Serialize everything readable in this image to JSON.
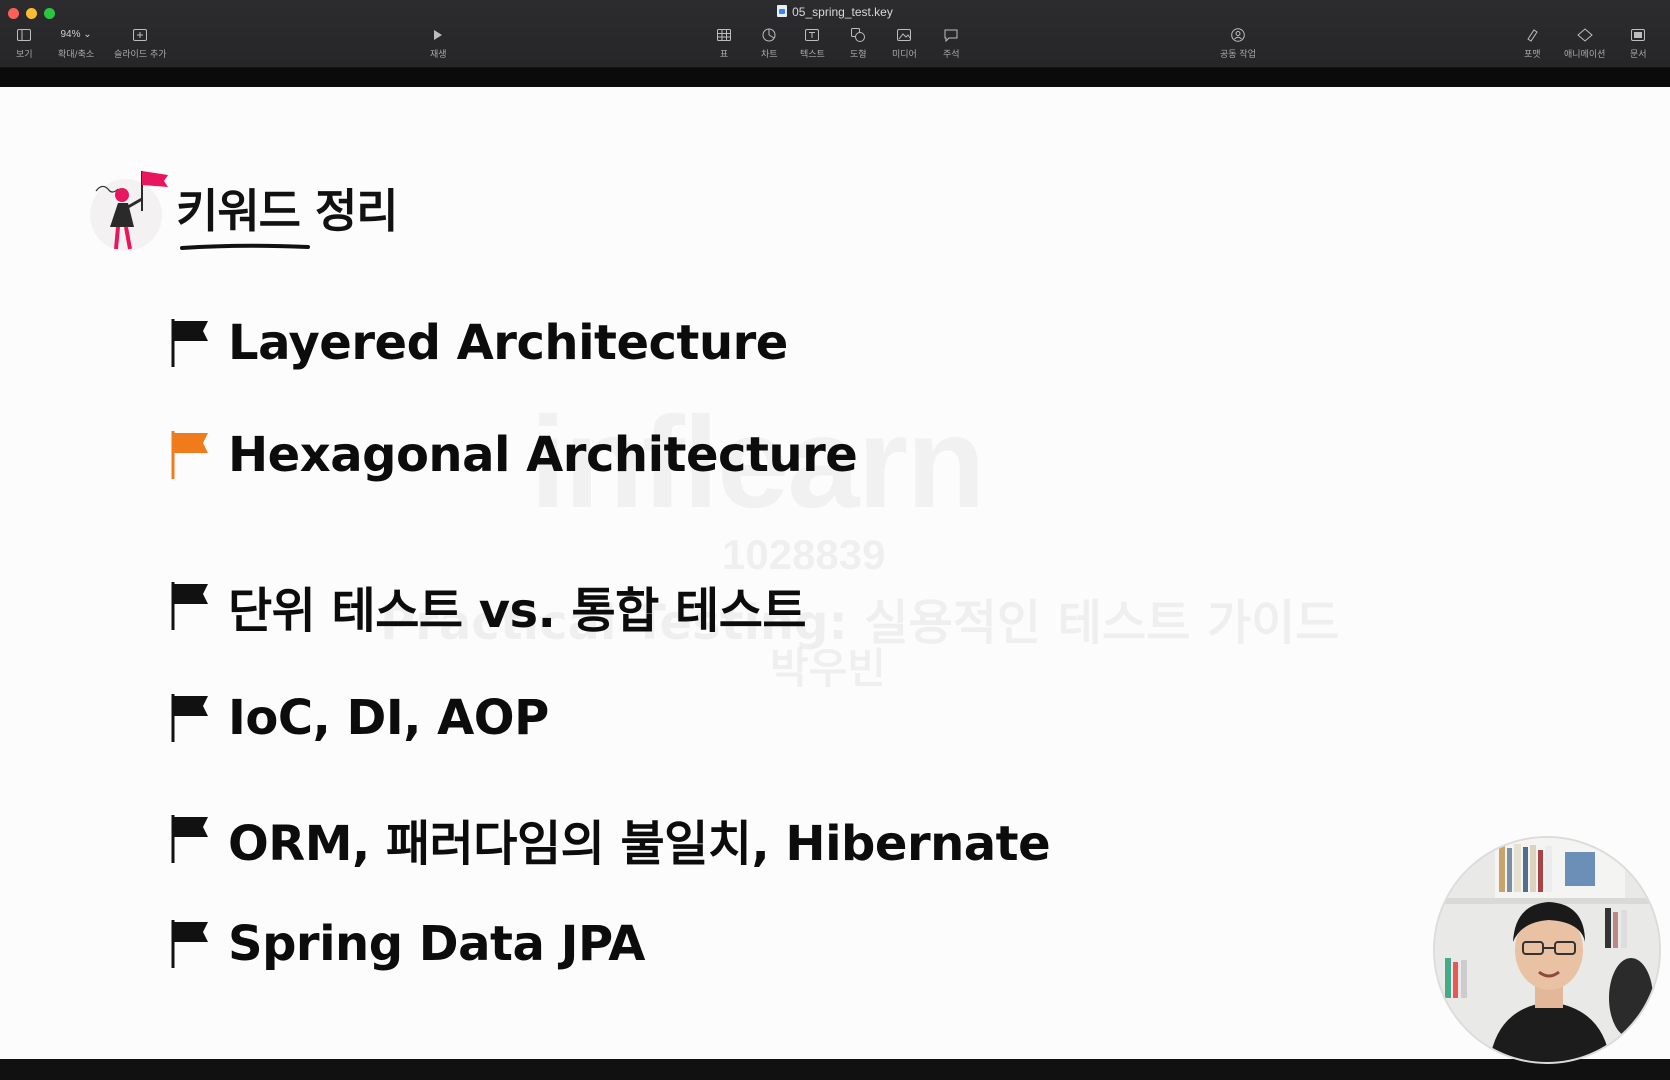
{
  "window": {
    "file_name": "05_spring_test.key"
  },
  "toolbar": {
    "view_label": "보기",
    "zoom_value": "94%",
    "zoom_label": "확대/축소",
    "add_slide_label": "슬라이드 추가",
    "play_label": "재생",
    "table_label": "표",
    "chart_label": "차트",
    "text_label": "텍스트",
    "shape_label": "도형",
    "media_label": "미디어",
    "comment_label": "주석",
    "collaborate_label": "공동 작업",
    "format_label": "포맷",
    "animate_label": "애니메이션",
    "document_label": "문서"
  },
  "slide": {
    "title": "키워드 정리",
    "keywords": [
      {
        "text": "Layered Architecture",
        "flag_color": "#111111"
      },
      {
        "text": "Hexagonal Architecture",
        "flag_color": "#f07b1a"
      },
      {
        "text": "단위 테스트 vs. 통합 테스트",
        "flag_color": "#111111"
      },
      {
        "text": "IoC, DI, AOP",
        "flag_color": "#111111"
      },
      {
        "text": "ORM, 패러다임의 불일치, Hibernate",
        "flag_color": "#111111"
      },
      {
        "text": "Spring Data JPA",
        "flag_color": "#111111"
      }
    ],
    "accent_color": "#e8175d"
  },
  "watermark": {
    "logo": "inflearn",
    "id": "1028839",
    "course": "Practical Testing: 실용적인 테스트 가이드",
    "author": "박우빈"
  }
}
